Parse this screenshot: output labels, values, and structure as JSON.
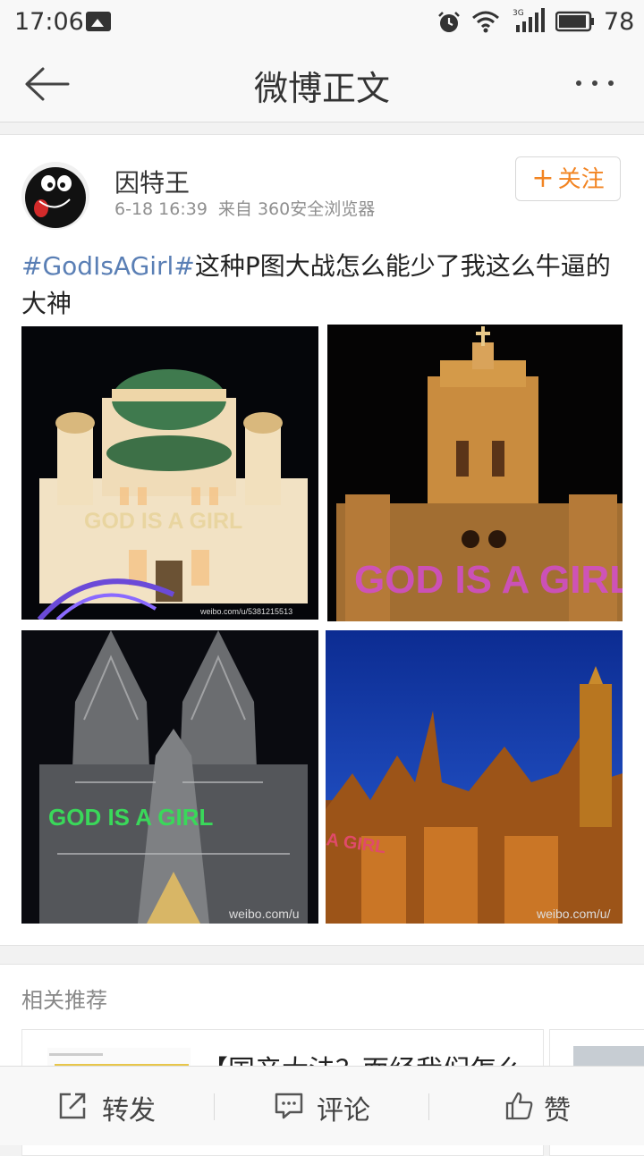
{
  "status_bar": {
    "time": "17:06",
    "network": "3G",
    "battery": "78",
    "icons": [
      "image-icon",
      "alarm-icon",
      "wifi-icon",
      "signal-icon",
      "battery-icon"
    ]
  },
  "header": {
    "title": "微博正文",
    "back_icon": "arrow-left-icon",
    "more_icon": "more-dots-icon"
  },
  "post": {
    "author": "因特王",
    "time": "6-18 16:39",
    "source": "来自 360安全浏览器",
    "follow_label": "关注",
    "hashtag": "#GodIsAGirl#",
    "text": "这种P图大战怎么能少了我这么牛逼的大神",
    "images": [
      {
        "overlay_text": "GOD IS A GIRL",
        "watermark": "weibo.com/u/5381215513"
      },
      {
        "overlay_text": "GOD IS A GIRL",
        "watermark": ""
      },
      {
        "overlay_text": "GOD IS A GIRL",
        "watermark": "weibo.com/u"
      },
      {
        "overlay_text": "A GIRL",
        "watermark": "weibo.com/u/"
      }
    ]
  },
  "related": {
    "title": "相关推荐",
    "first_card_text": "【国产大法？面经我们怎么"
  },
  "bottom_bar": {
    "repost": "转发",
    "comment": "评论",
    "like": "赞"
  },
  "colors": {
    "accent_orange": "#f28422",
    "link_blue": "#5a7fb5"
  }
}
